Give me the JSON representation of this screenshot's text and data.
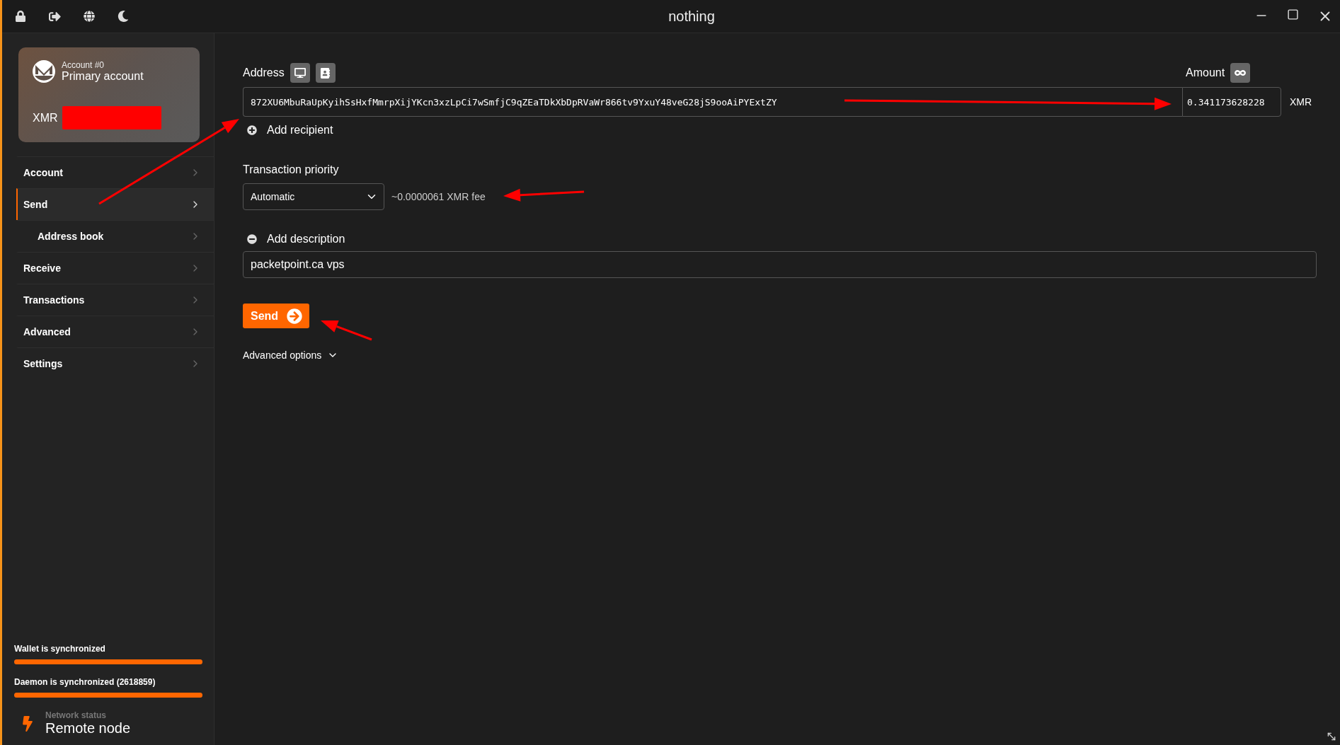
{
  "window": {
    "title": "nothing"
  },
  "account_card": {
    "account_number": "Account #0",
    "account_name": "Primary account",
    "currency": "XMR"
  },
  "sidebar": {
    "items": [
      {
        "label": "Account",
        "selected": false
      },
      {
        "label": "Send",
        "selected": true,
        "children": [
          {
            "label": "Address book",
            "selected": false
          }
        ]
      },
      {
        "label": "Receive",
        "selected": false
      },
      {
        "label": "Transactions",
        "selected": false
      },
      {
        "label": "Advanced",
        "selected": false
      },
      {
        "label": "Settings",
        "selected": false
      }
    ]
  },
  "send_form": {
    "address_label": "Address",
    "address": "872XU6MbuRaUpKyihSsHxfMmrpXijYKcn3xzLpCi7wSmfjC9qZEaTDkXbDpRVaWr866tv9YxuY48veG28jS9ooAiPYExtZY",
    "amount_label": "Amount",
    "amount": "0.341173628228",
    "currency": "XMR",
    "add_recipient": "Add recipient",
    "priority_label": "Transaction priority",
    "priority": "Automatic",
    "fee": "~0.0000061 XMR fee",
    "add_description": "Add description",
    "description": "packetpoint.ca vps",
    "send_button": "Send",
    "advanced_options": "Advanced options"
  },
  "status": {
    "wallet": {
      "label": "Wallet is synchronized",
      "level": 1
    },
    "daemon": {
      "label": "Daemon is synchronized (2618859)",
      "level": 1
    },
    "network_label": "Network status",
    "network": "Remote node"
  }
}
